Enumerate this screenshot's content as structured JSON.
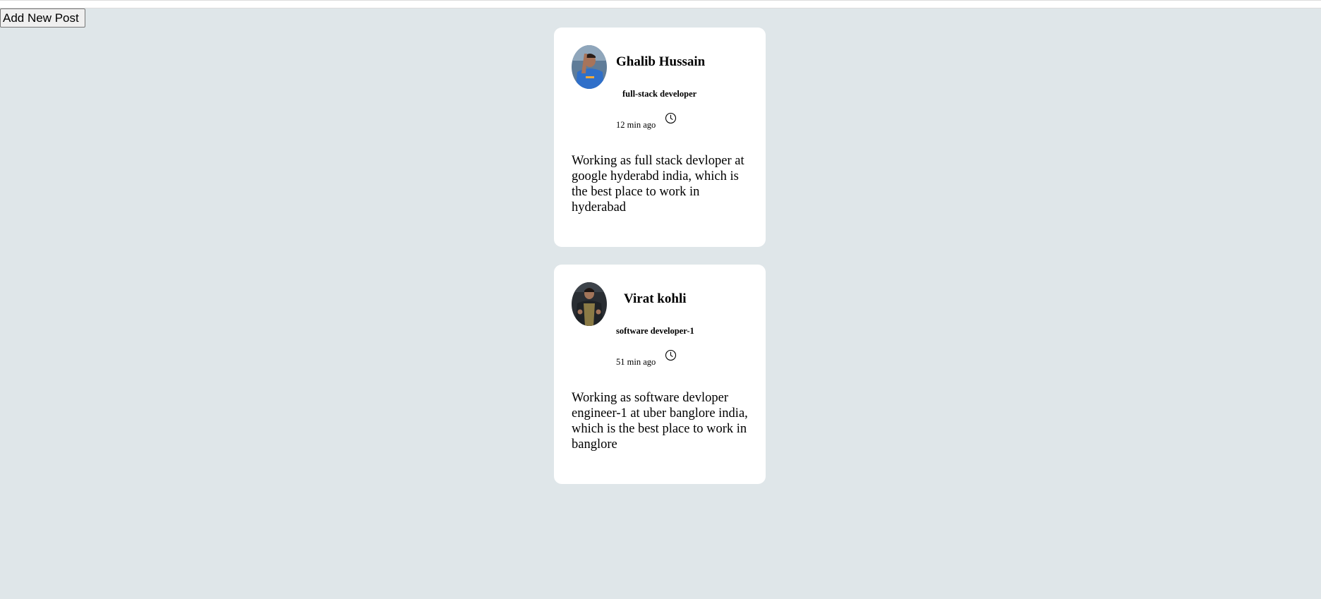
{
  "toolbar": {
    "add_label": "Add New Post"
  },
  "posts": [
    {
      "author": "Ghalib Hussain",
      "role": "full-stack developer",
      "time": "12 min ago",
      "time_icon": "clock-icon",
      "body": "Working as full stack devloper at google hyderabd india, which is the best place to work in hyderabad",
      "avatar_desc": "profile photo (person in blue jersey)"
    },
    {
      "author": "Virat kohli",
      "role": "software developer-1",
      "time": "51 min ago",
      "time_icon": "clock-icon",
      "body": "Working as software devloper engineer-1 at uber banglore india, which is the best place to work in banglore",
      "avatar_desc": "profile photo (person in dark jacket)"
    }
  ],
  "colors": {
    "page_background": "#dfe6e9",
    "card_background": "#ffffff"
  }
}
